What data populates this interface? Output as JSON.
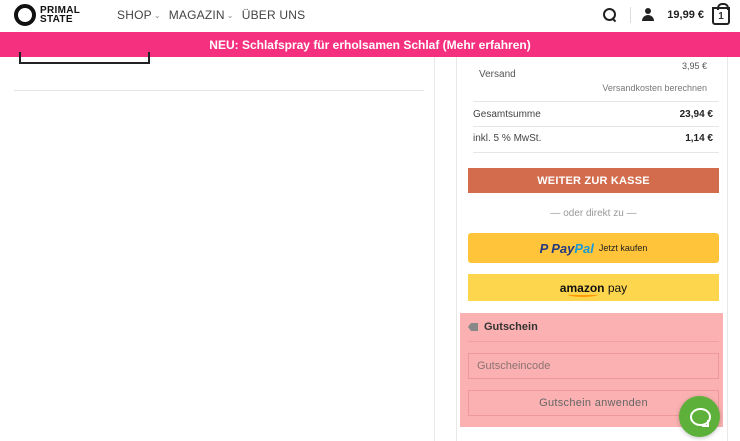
{
  "header": {
    "logo_line1": "PRIMAL",
    "logo_line2": "STATE",
    "nav": [
      {
        "label": "SHOP",
        "has_dropdown": true
      },
      {
        "label": "MAGAZIN",
        "has_dropdown": true
      },
      {
        "label": "ÜBER UNS",
        "has_dropdown": false
      }
    ],
    "cart_total": "19,99 €",
    "cart_count": "1",
    "icons": [
      "search-icon",
      "user-icon",
      "cart-icon"
    ]
  },
  "promo": {
    "text": "NEU: Schlafspray für erholsamen Schlaf (Mehr erfahren)",
    "color": "#f5317f"
  },
  "cart_summary": {
    "shipping_price": "3,95 €",
    "shipping_label": "Versand",
    "shipping_calc": "Versandkosten berechnen",
    "total_label": "Gesamtsumme",
    "total_value": "23,94 €",
    "vat_label": "inkl. 5 % MwSt.",
    "vat_value": "1,14 €",
    "checkout_label": "WEITER ZUR KASSE",
    "checkout_color": "#d26c4d",
    "or_direct": "— oder direkt zu —",
    "paypal": {
      "brand_part1": "Pay",
      "brand_part2": "Pal",
      "cta": "Jetzt kaufen",
      "color": "#ffc439"
    },
    "amazon": {
      "brand": "amazon",
      "suffix": "pay",
      "color": "#fdd64e"
    }
  },
  "coupon": {
    "title": "Gutschein",
    "placeholder": "Gutscheincode",
    "apply_label": "Gutschein anwenden",
    "highlight_color": "#fbb1b1"
  },
  "chat": {
    "icon": "chat-icon",
    "color": "#5db13a"
  }
}
